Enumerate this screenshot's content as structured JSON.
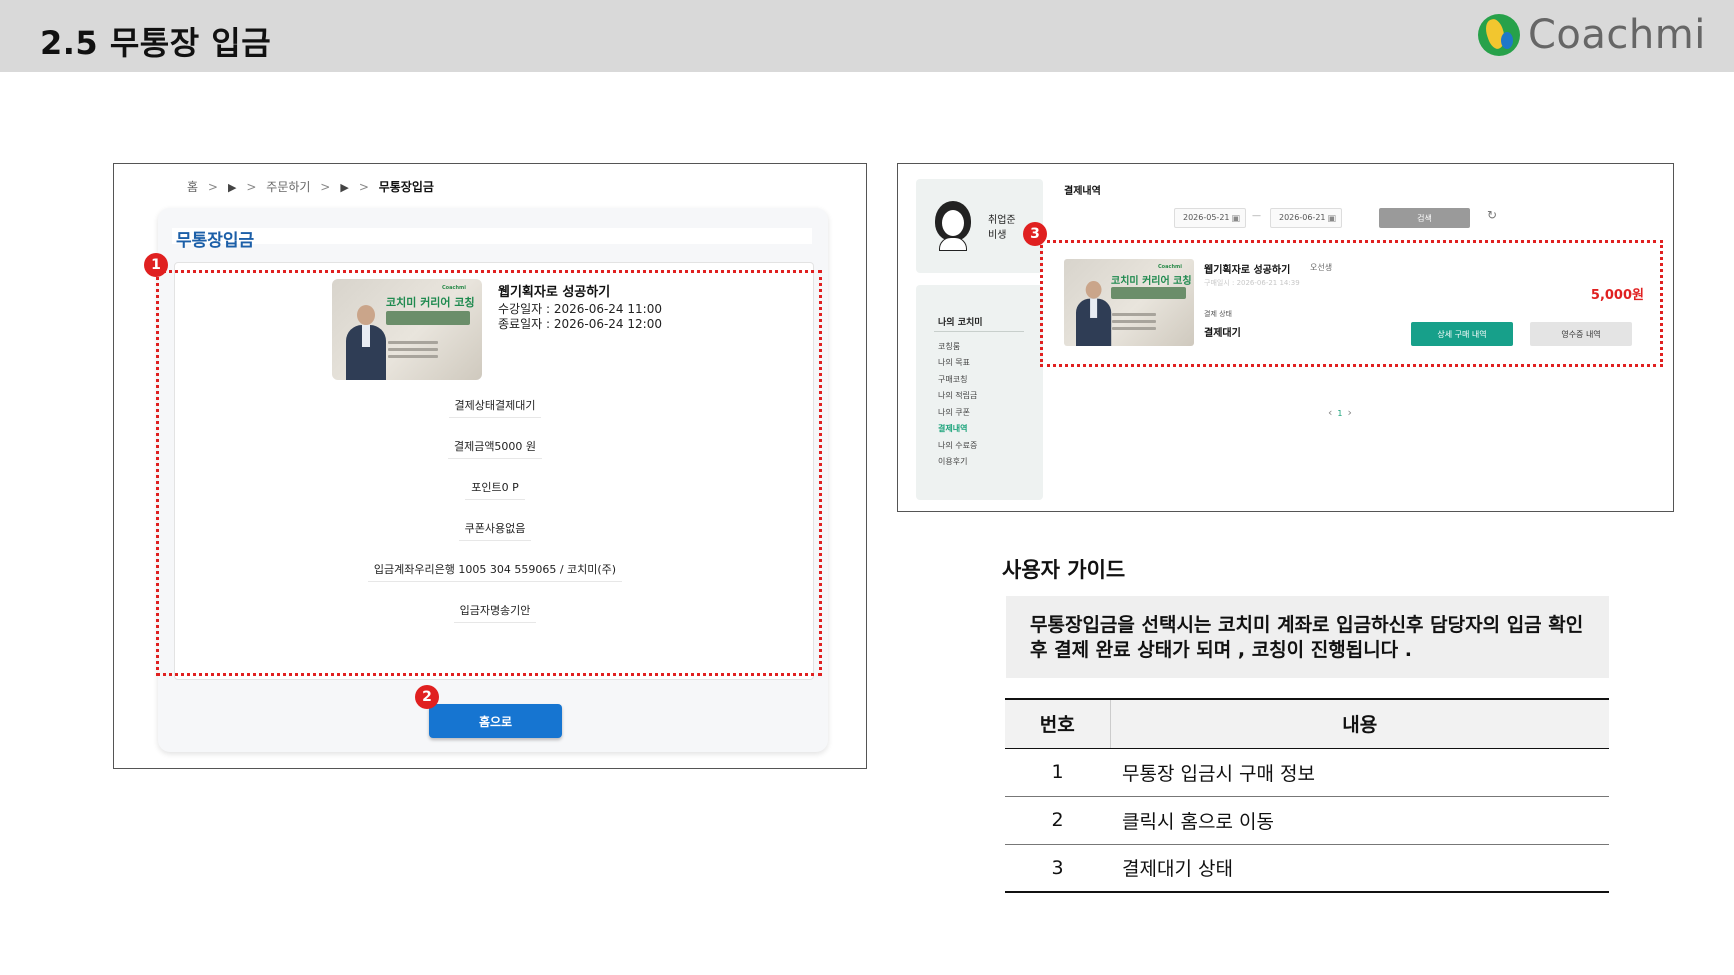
{
  "page": {
    "title": "2.5  무통장 입금",
    "logo_text": "Coachmi"
  },
  "left_screen": {
    "breadcrumb": [
      "홈",
      "주문하기",
      "무통장입금"
    ],
    "panel_title": "무통장입금",
    "course": {
      "thumb_title": "코치미 커리어 코칭",
      "title": "웹기획자로 성공하기",
      "start": "수강일자 : 2026-06-24 11:00",
      "end": "종료일자 : 2026-06-24 12:00"
    },
    "info": {
      "status": "결제상태결제대기",
      "amount": "결제금액5000 원",
      "point": "포인트0 P",
      "coupon": "쿠폰사용없음",
      "account": "입금계좌우리은행 1005 304 559065 / 코치미(주)",
      "depositor": "입금자명송기안"
    },
    "home_button": "홈으로"
  },
  "right_screen": {
    "profile_name": "취업준\n비생",
    "menu_title": "나의 코치미",
    "menu_items": [
      "코칭룸",
      "나의 목표",
      "구매코칭",
      "나의 적립금",
      "나의 쿠폰",
      "결제내역",
      "나의 수료증",
      "이용후기"
    ],
    "heading": "결제내역",
    "date_from": "2026-05-21",
    "date_to": "2026-06-21",
    "search_button": "검색",
    "item": {
      "thumb_title": "코치미 커리어 코칭",
      "course": "웹기획자로 성공하기",
      "instructor": "오선생",
      "purchased_at": "구매일시 : 2026-06-21 14:39",
      "status_label": "결제 상태",
      "status": "결제대기",
      "amount": "5,000원",
      "detail_button": "상세 구매 내역",
      "receipt_button": "영수증 내역"
    },
    "page_number": "1"
  },
  "badges": [
    "1",
    "2",
    "3"
  ],
  "guide": {
    "heading": "사용자 가이드",
    "text": "무통장입금을 선택시는 코치미 계좌로 입금하신후 담당자의 입금 확인후 결제 완료 상태가 되며 ,  코칭이 진행됩니다 .",
    "table": {
      "headers": [
        "번호",
        "내용"
      ],
      "rows": [
        {
          "no": "1",
          "desc": "무통장 입금시 구매 정보"
        },
        {
          "no": "2",
          "desc": "클릭시 홈으로 이동"
        },
        {
          "no": "3",
          "desc": "결제대기 상태"
        }
      ]
    }
  },
  "colors": {
    "header_bg": "#d9d9d9",
    "accent_blue": "#1675d1",
    "accent_teal": "#17a08a",
    "highlight_red": "#e02020"
  }
}
